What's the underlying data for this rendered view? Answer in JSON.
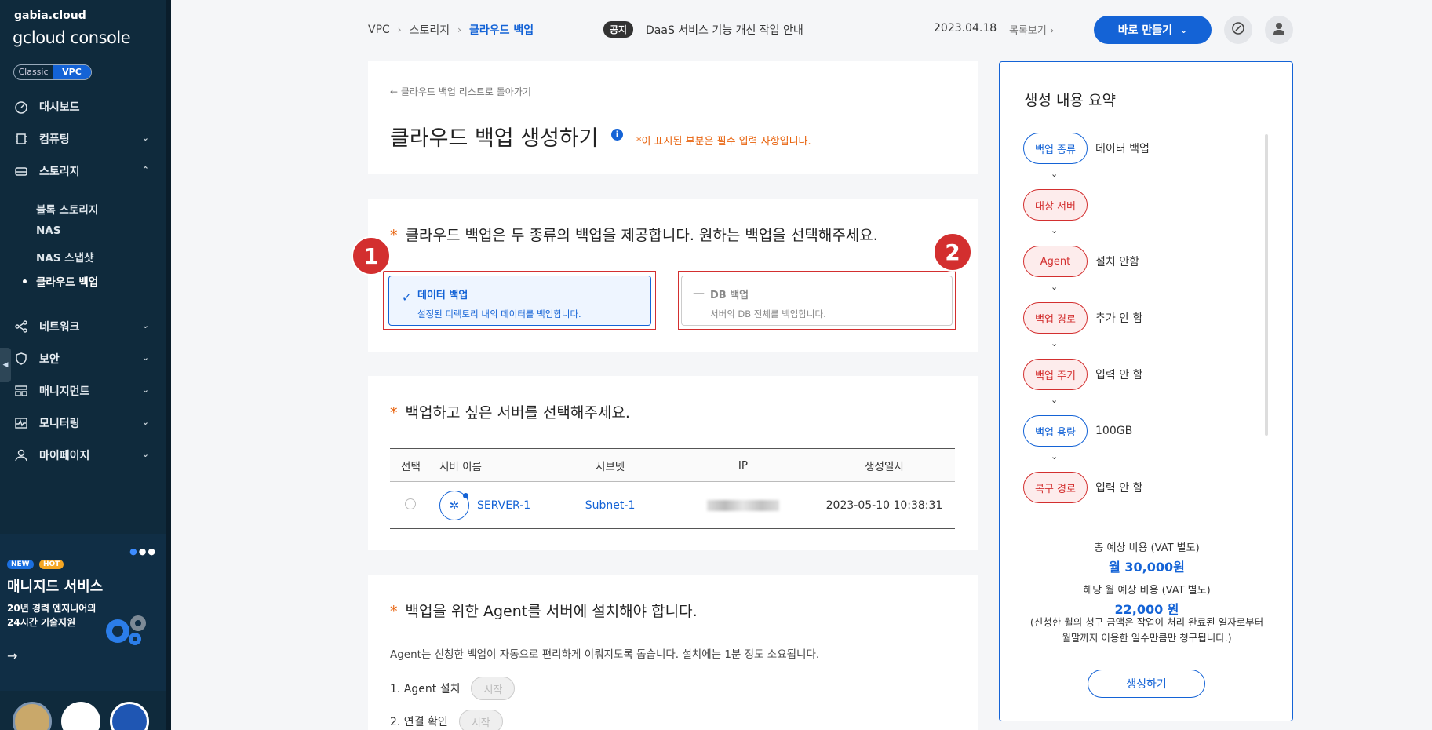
{
  "sidebar": {
    "brand_top": "gabia.cloud",
    "brand_main": "gcloud console",
    "mode": {
      "classic": "Classic",
      "vpc": "VPC"
    },
    "items": [
      {
        "label": "대시보드",
        "icon": "dashboard-icon"
      },
      {
        "label": "컴퓨팅",
        "icon": "cpu-icon"
      },
      {
        "label": "스토리지",
        "icon": "storage-icon"
      },
      {
        "label": "네트워크",
        "icon": "network-icon"
      },
      {
        "label": "보안",
        "icon": "shield-icon"
      },
      {
        "label": "매니지먼트",
        "icon": "management-icon"
      },
      {
        "label": "모니터링",
        "icon": "monitoring-icon"
      },
      {
        "label": "마이페이지",
        "icon": "user-icon"
      }
    ],
    "storage_sub": [
      "블록 스토리지",
      "NAS",
      "NAS 스냅샷",
      "클라우드 백업"
    ],
    "promo": {
      "badge_new": "NEW",
      "badge_hot": "HOT",
      "title": "매니지드 서비스",
      "line1": "20년 경력 엔지니어의",
      "line2": "24시간 기술지원"
    }
  },
  "header": {
    "breadcrumb": [
      "VPC",
      "스토리지",
      "클라우드 백업"
    ],
    "notice_badge": "공지",
    "notice_text": "DaaS 서비스 기능 개선 작업 안내",
    "notice_date": "2023.04.18",
    "notice_more": "목록보기",
    "create_now": "바로 만들기"
  },
  "page": {
    "back_link": "클라우드 백업 리스트로 돌아가기",
    "title": "클라우드 백업 생성하기",
    "required_note": "*이 표시된 부분은 필수 입력 사항입니다."
  },
  "backup_type": {
    "question": "클라우드 백업은 두 종류의 백업을 제공합니다. 원하는 백업을 선택해주세요.",
    "options": [
      {
        "title": "데이터 백업",
        "desc": "설정된 디렉토리 내의 데이터를 백업합니다.",
        "selected": true
      },
      {
        "title": "DB 백업",
        "desc": "서버의 DB 전체를 백업합니다.",
        "selected": false
      }
    ],
    "markers": [
      "1",
      "2"
    ]
  },
  "server_select": {
    "question": "백업하고 싶은 서버를 선택해주세요.",
    "columns": [
      "선택",
      "서버 이름",
      "서브넷",
      "IP",
      "생성일시"
    ],
    "rows": [
      {
        "name": "SERVER-1",
        "subnet": "Subnet-1",
        "created": "2023-05-10 10:38:31"
      }
    ]
  },
  "agent": {
    "question": "백업을 위한 Agent를 서버에 설치해야 합니다.",
    "desc": "Agent는 신청한 백업이 자동으로 편리하게 이뤄지도록 돕습니다. 설치에는 1분 정도 소요됩니다.",
    "steps": [
      {
        "label": "1. Agent 설치",
        "button": "시작"
      },
      {
        "label": "2. 연결 확인",
        "button": "시작"
      }
    ]
  },
  "summary": {
    "title": "생성 내용 요약",
    "items": [
      {
        "label": "백업 종류",
        "value": "데이터 백업",
        "state": "blue"
      },
      {
        "label": "대상 서버",
        "value": "",
        "state": "red"
      },
      {
        "label": "Agent",
        "value": "설치 안함",
        "state": "red"
      },
      {
        "label": "백업 경로",
        "value": "추가 안 함",
        "state": "red"
      },
      {
        "label": "백업 주기",
        "value": "입력 안 함",
        "state": "red"
      },
      {
        "label": "백업 용량",
        "value": "100GB",
        "state": "blue"
      },
      {
        "label": "복구 경로",
        "value": "입력 안 함",
        "state": "red"
      }
    ],
    "total_label": "총 예상 비용 (VAT 별도)",
    "total_value": "월 30,000원",
    "month_label": "해당 월 예상 비용 (VAT 별도)",
    "month_value": "22,000 원",
    "note_line1": "(신청한 월의 청구 금액은 작업이 처리 완료된 일자로부터",
    "note_line2": "월말까지 이용한 일수만큼만 청구됩니다.)",
    "create_button": "생성하기"
  },
  "colors": {
    "accent": "#1463d6",
    "danger": "#d32f2f",
    "warning": "#e8620c",
    "sidebar": "#0f2a3c"
  }
}
